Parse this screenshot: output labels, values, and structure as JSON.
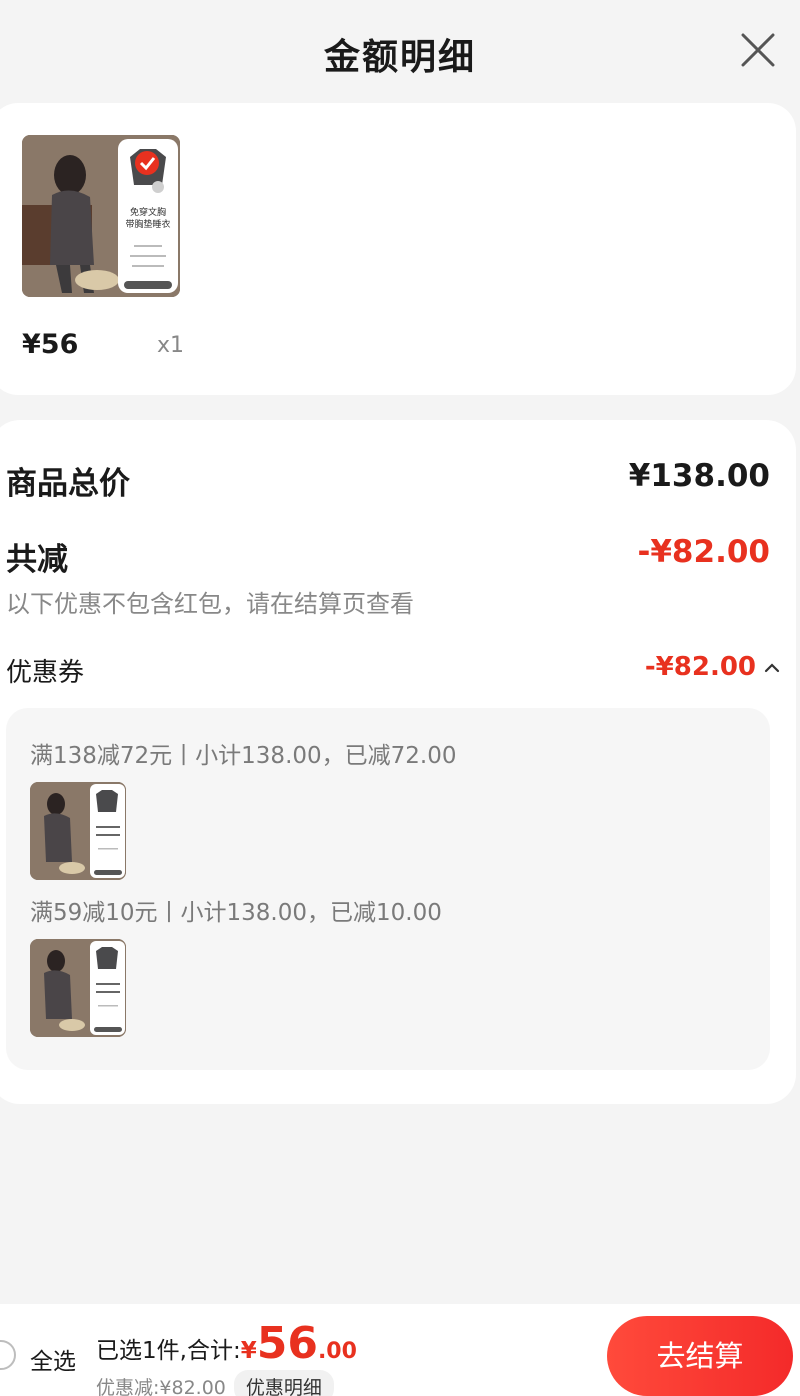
{
  "header": {
    "title": "金额明细"
  },
  "product": {
    "price": "¥56",
    "quantity": "x1",
    "image_text": {
      "line1": "免穿文胸",
      "line2": "带胸垫睡衣"
    }
  },
  "summary": {
    "total_label": "商品总价",
    "total_value": "¥138.00",
    "reduce_label": "共减",
    "reduce_value": "-¥82.00",
    "note": "以下优惠不包含红包，请在结算页查看",
    "coupon_label": "优惠券",
    "coupon_value": "-¥82.00",
    "rules": [
      {
        "text": "满138减72元丨小计138.00，已减72.00"
      },
      {
        "text": "满59减10元丨小计138.00，已减10.00"
      }
    ]
  },
  "bottom": {
    "select_all": "全选",
    "selected_text": "已选1件,合计:",
    "price_symbol": "¥",
    "price_int": "56",
    "price_dec": ".00",
    "discount_text": "优惠减:¥82.00",
    "discount_detail": "优惠明细",
    "checkout": "去结算"
  },
  "colors": {
    "accent": "#e8311f",
    "button": "#f42a2a"
  }
}
